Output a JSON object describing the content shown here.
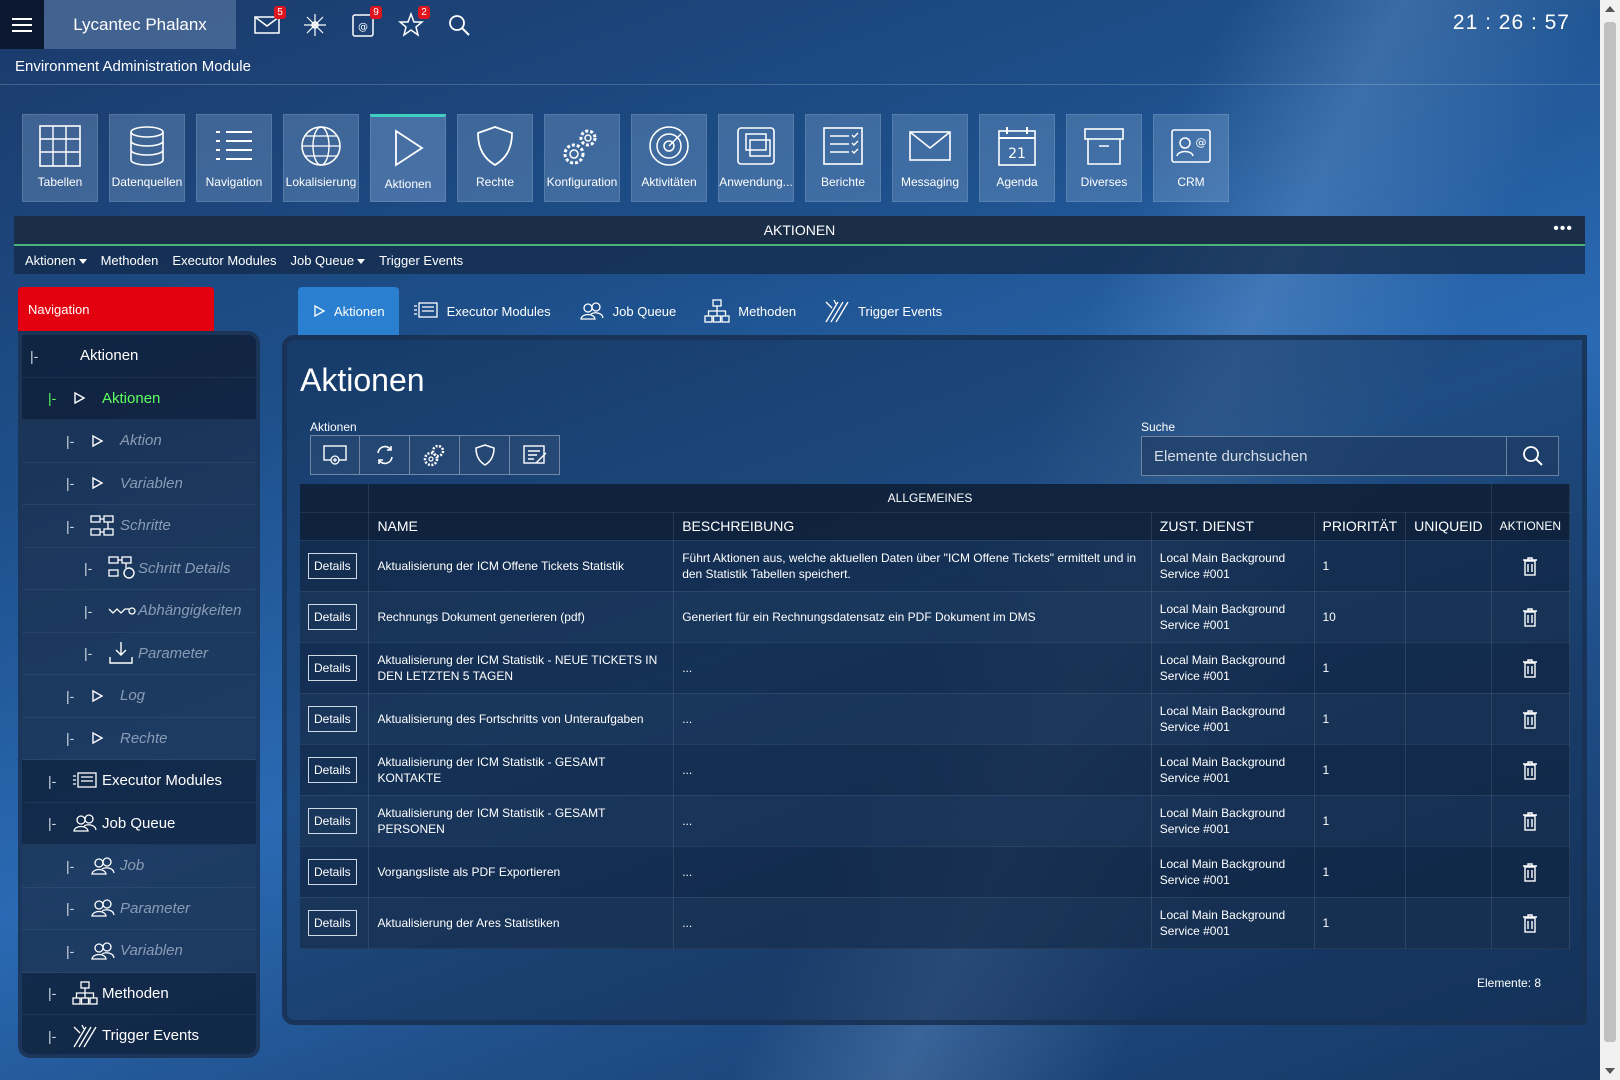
{
  "topbar": {
    "app_title": "Lycantec Phalanx",
    "clock": "21 : 26 : 57",
    "icons": [
      {
        "name": "mail-icon",
        "badge": "5"
      },
      {
        "name": "sparkle-icon",
        "badge": ""
      },
      {
        "name": "contact-card-icon",
        "badge": "9"
      },
      {
        "name": "star-icon",
        "badge": "2"
      },
      {
        "name": "search-icon",
        "badge": ""
      }
    ]
  },
  "subtitle": "Environment Administration Module",
  "tiles": [
    {
      "label": "Tabellen",
      "icon": "table-icon"
    },
    {
      "label": "Datenquellen",
      "icon": "database-icon"
    },
    {
      "label": "Navigation",
      "icon": "list-icon"
    },
    {
      "label": "Lokalisierung",
      "icon": "globe-icon"
    },
    {
      "label": "Aktionen",
      "icon": "play-icon"
    },
    {
      "label": "Rechte",
      "icon": "shield-icon"
    },
    {
      "label": "Konfiguration",
      "icon": "gears-icon"
    },
    {
      "label": "Aktivitäten",
      "icon": "radar-icon"
    },
    {
      "label": "Anwendung...",
      "icon": "windows-icon"
    },
    {
      "label": "Berichte",
      "icon": "report-icon"
    },
    {
      "label": "Messaging",
      "icon": "envelope-icon"
    },
    {
      "label": "Agenda",
      "icon": "calendar-icon",
      "day": "21"
    },
    {
      "label": "Diverses",
      "icon": "archive-icon"
    },
    {
      "label": "CRM",
      "icon": "crm-icon"
    }
  ],
  "panel": {
    "title": "AKTIONEN",
    "menu": [
      "Aktionen",
      "Methoden",
      "Executor Modules",
      "Job Queue",
      "Trigger Events"
    ]
  },
  "nav": {
    "tab_label": "Navigation",
    "items": [
      {
        "pipe": "|-",
        "label": "Aktionen"
      },
      {
        "pipe": "|-",
        "label": "Aktionen"
      },
      {
        "pipe": "|-",
        "label": "Aktion"
      },
      {
        "pipe": "|-",
        "label": "Variablen"
      },
      {
        "pipe": "|-",
        "label": "Schritte"
      },
      {
        "pipe": "|-",
        "label": "Schritt Details"
      },
      {
        "pipe": "|-",
        "label": "Abhängigkeiten"
      },
      {
        "pipe": "|-",
        "label": "Parameter"
      },
      {
        "pipe": "|-",
        "label": "Log"
      },
      {
        "pipe": "|-",
        "label": "Rechte"
      },
      {
        "pipe": "|-",
        "label": "Executor Modules"
      },
      {
        "pipe": "|-",
        "label": "Job Queue"
      },
      {
        "pipe": "|-",
        "label": "Job"
      },
      {
        "pipe": "|-",
        "label": "Parameter"
      },
      {
        "pipe": "|-",
        "label": "Variablen"
      },
      {
        "pipe": "|-",
        "label": "Methoden"
      },
      {
        "pipe": "|-",
        "label": "Trigger Events"
      }
    ]
  },
  "content": {
    "tabs": [
      "Aktionen",
      "Executor Modules",
      "Job Queue",
      "Methoden",
      "Trigger Events"
    ],
    "heading": "Aktionen",
    "actions_label": "Aktionen",
    "search_label": "Suche",
    "search_placeholder": "Elemente durchsuchen",
    "table": {
      "group_header": "ALLGEMEINES",
      "columns": [
        "NAME",
        "BESCHREIBUNG",
        "ZUST. DIENST",
        "PRIORITÄT",
        "UNIQUEID",
        "AKTIONEN"
      ],
      "details_label": "Details",
      "rows": [
        {
          "name": "Aktualisierung der ICM Offene Tickets Statistik",
          "desc": "Führt Aktionen aus, welche aktuellen Daten über \"ICM Offene Tickets\" ermittelt und in den Statistik Tabellen speichert.",
          "service": "Local Main Background Service #001",
          "priority": "1",
          "uid": ""
        },
        {
          "name": "Rechnungs Dokument generieren (pdf)",
          "desc": "Generiert für ein Rechnungsdatensatz ein PDF Dokument im DMS",
          "service": "Local Main Background Service #001",
          "priority": "10",
          "uid": ""
        },
        {
          "name": "Aktualisierung der ICM Statistik - NEUE TICKETS IN DEN LETZTEN 5 TAGEN",
          "desc": "...",
          "service": "Local Main Background Service #001",
          "priority": "1",
          "uid": ""
        },
        {
          "name": "Aktualisierung des Fortschritts von Unteraufgaben",
          "desc": "...",
          "service": "Local Main Background Service #001",
          "priority": "1",
          "uid": ""
        },
        {
          "name": "Aktualisierung der ICM Statistik - GESAMT KONTAKTE",
          "desc": "...",
          "service": "Local Main Background Service #001",
          "priority": "1",
          "uid": ""
        },
        {
          "name": "Aktualisierung der ICM Statistik - GESAMT PERSONEN",
          "desc": "...",
          "service": "Local Main Background Service #001",
          "priority": "1",
          "uid": ""
        },
        {
          "name": "Vorgangsliste als PDF Exportieren",
          "desc": "...",
          "service": "Local Main Background Service #001",
          "priority": "1",
          "uid": ""
        },
        {
          "name": "Aktualisierung der Ares Statistiken",
          "desc": "...",
          "service": "Local Main Background Service #001",
          "priority": "1",
          "uid": ""
        }
      ]
    },
    "footer_count": "Elemente: 8"
  },
  "colors": {
    "active_nav": "#5dff5d",
    "nav_tab": "#e3000f",
    "active_tab": "#2a7fd0",
    "active_tile_accent": "#3fd0c0",
    "badge": "#e0141e"
  }
}
